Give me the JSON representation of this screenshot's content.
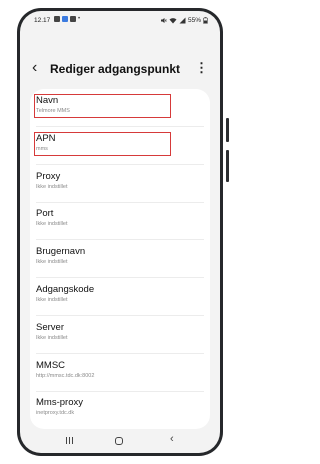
{
  "status": {
    "time": "12.17",
    "battery": "55%",
    "notif_colors": [
      "#444444",
      "#3b7be0",
      "#444444",
      "#777777"
    ]
  },
  "header": {
    "back_icon": "‹",
    "title": "Rediger adgangspunkt",
    "more_icon": "⋮"
  },
  "settings": [
    {
      "label": "Navn",
      "value": "Telmore MMS",
      "highlighted": true
    },
    {
      "label": "APN",
      "value": "mms",
      "highlighted": true
    },
    {
      "label": "Proxy",
      "value": "Ikke indstillet",
      "highlighted": false
    },
    {
      "label": "Port",
      "value": "Ikke indstillet",
      "highlighted": false
    },
    {
      "label": "Brugernavn",
      "value": "Ikke indstillet",
      "highlighted": false
    },
    {
      "label": "Adgangskode",
      "value": "Ikke indstillet",
      "highlighted": false
    },
    {
      "label": "Server",
      "value": "Ikke indstillet",
      "highlighted": false
    },
    {
      "label": "MMSC",
      "value": "http://mmsc.tdc.dk:8002",
      "highlighted": false
    },
    {
      "label": "Mms-proxy",
      "value": "inetproxy.tdc.dk",
      "highlighted": false
    }
  ],
  "navbar": {
    "recent_icon": "recent-apps-icon",
    "home_icon": "home-icon",
    "back_icon": "‹"
  },
  "colors": {
    "highlight": "#d63a3a",
    "background": "#f3f3f3",
    "card": "#ffffff"
  }
}
